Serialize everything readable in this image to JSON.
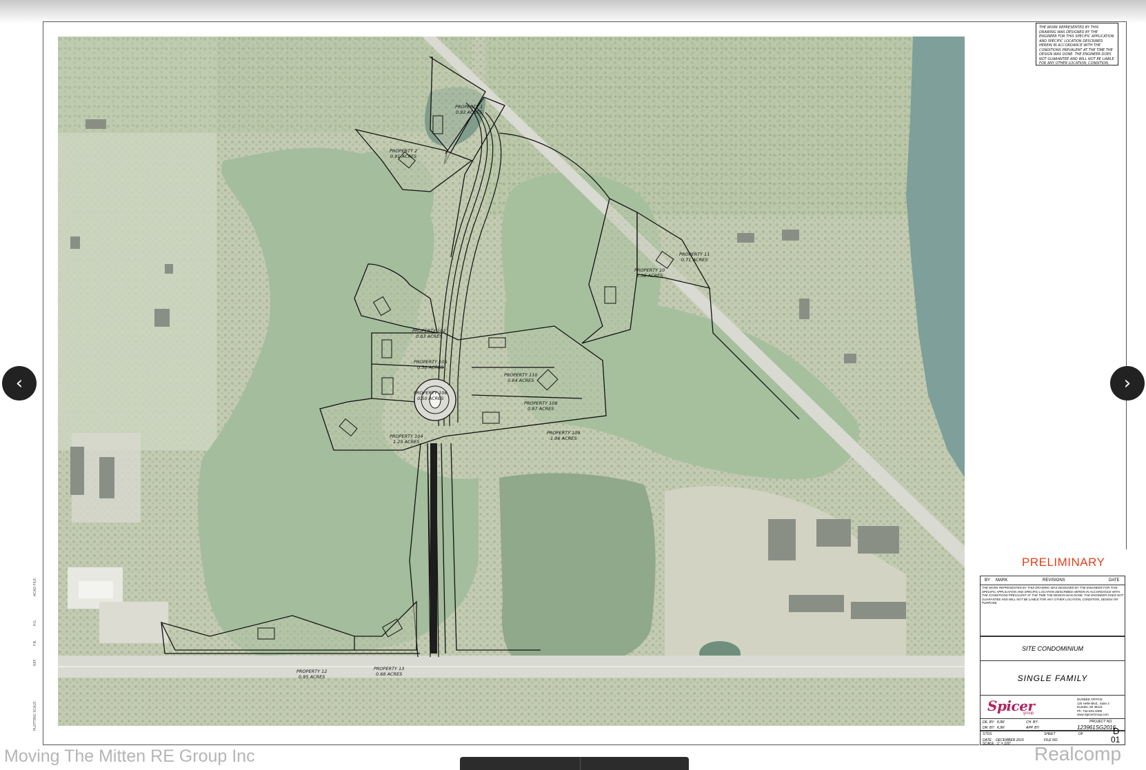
{
  "disclaimer": "The work represented by this drawing was designed by the engineer for this specific application and specific location described herein in accordance with the conditions prevalent at the time the design was done. The engineer does not guarantee and will not be liable for any other location, condition, design or purpose. Duplication or distribution of this drawing is prohibited without the written consent of Spicer Engineering Company.",
  "properties": [
    {
      "name": "PROPERTY 1",
      "acres": "0.92 ACRES"
    },
    {
      "name": "PROPERTY 2",
      "acres": "0.91 ACRES"
    },
    {
      "name": "PROPERTY 10",
      "acres": "1.38 ACRES"
    },
    {
      "name": "PROPERTY 11",
      "acres": "0.71 ACRES"
    },
    {
      "name": "PROPERTY 102",
      "acres": "0.83 ACRES"
    },
    {
      "name": "PROPERTY 105",
      "acres": "0.50 ACRES"
    },
    {
      "name": "PROPERTY 110",
      "acres": "0.84 ACRES"
    },
    {
      "name": "PROPERTY 106",
      "acres": "0.50 ACRES"
    },
    {
      "name": "PROPERTY 108",
      "acres": "0.97 ACRES"
    },
    {
      "name": "PROPERTY 104",
      "acres": "1.25 ACRES"
    },
    {
      "name": "PROPERTY 109",
      "acres": "1.06 ACRES"
    },
    {
      "name": "PROPERTY 12",
      "acres": "0.95 ACRES"
    },
    {
      "name": "PROPERTY 13",
      "acres": "0.68 ACRES"
    }
  ],
  "title_block": {
    "status": "PRELIMINARY",
    "rev_headers": [
      "BY",
      "MARK",
      "REVISIONS",
      "DATE"
    ],
    "rev_note": "The work represented by this drawing was designed by the engineer for this specific application and specific location described herein in accordance with the conditions prevalent at the time the design was done. The engineer does not guarantee and will not be liable for any other location, condition, design or purpose.",
    "project_type": "SITE CONDOMINIUM",
    "project_subtype": "SINGLE FAMILY",
    "company_logo": "Spicer",
    "company_logo_sub": "group",
    "office_lines": [
      "DUNDEE OFFICE",
      "125 Helle Blvd., Suite 2",
      "Dundee, MI 48131",
      "Ph: 734-823-3308",
      "www.SpicerGroup.com"
    ],
    "de_by": "DE. BY:",
    "de_by_val": "KJW",
    "dr_by": "DR. BY:",
    "dr_by_val": "KJW",
    "ch_by": "CH. BY:",
    "app_by": "APP. BY:",
    "project_no_label": "PROJECT NO.",
    "project_no": "123961SG2016",
    "stds": "STDS.",
    "sheet_label": "SHEET",
    "of_label": "OF",
    "date_label": "DATE",
    "date_value": "DECEMBER 2016",
    "file_no": "FILE NO.",
    "scale_label": "SCALE",
    "scale_value": "1\" = 100'",
    "sheet_id_top": "D",
    "sheet_id_bottom": "01"
  },
  "side_labels": [
    "ACAD FILE:",
    "P.G.",
    "F.B.",
    "REF.",
    "PLOTTING SCALE:"
  ],
  "nav": {
    "prev_glyph": "‹",
    "next_glyph": "›"
  },
  "watermarks": {
    "left": "Moving The Mitten RE Group Inc",
    "right": "Realcomp"
  },
  "colors": {
    "water": "#a6c09e",
    "land": "#c9d3b8",
    "lake": "#7fa09a",
    "road": "#d7d8d0",
    "preliminary": "#e0401a"
  }
}
